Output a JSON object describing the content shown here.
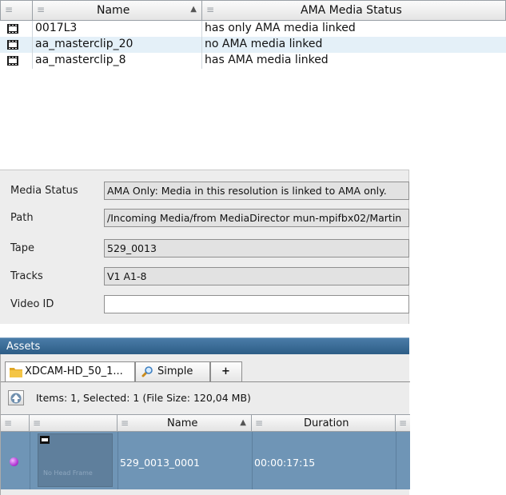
{
  "bin_table": {
    "columns": [
      {
        "label": ""
      },
      {
        "label": "Name"
      },
      {
        "label": "AMA Media Status"
      }
    ],
    "rows": [
      {
        "name": "0017L3",
        "status": "has only AMA media linked"
      },
      {
        "name": "aa_masterclip_20",
        "status": "no AMA media linked"
      },
      {
        "name": "aa_masterclip_8",
        "status": "has AMA media linked"
      }
    ]
  },
  "info_panel": {
    "media_status": {
      "label": "Media Status",
      "value": "AMA Only: Media in this resolution is linked to AMA only."
    },
    "path": {
      "label": "Path",
      "value": "/Incoming Media/from MediaDirector mun-mpifbx02/Martin"
    },
    "tape": {
      "label": "Tape",
      "value": "529_0013"
    },
    "tracks": {
      "label": "Tracks",
      "value": "V1 A1-8"
    },
    "video_id": {
      "label": "Video ID",
      "value": ""
    }
  },
  "assets": {
    "title": "Assets",
    "tabs": [
      {
        "label": "XDCAM-HD_50_1..."
      },
      {
        "label": "Simple"
      },
      {
        "label": "+"
      }
    ],
    "items_summary": "Items: 1, Selected: 1 (File Size: 120,04 MB)",
    "columns": [
      {
        "label": ""
      },
      {
        "label": ""
      },
      {
        "label": "Name"
      },
      {
        "label": "Duration"
      },
      {
        "label": ""
      }
    ],
    "rows": [
      {
        "thumbnail_text": "No Head Frame",
        "name": "529_0013_0001",
        "duration": "00:00:17:15"
      }
    ]
  },
  "colors": {
    "selection": "#6f95b6",
    "assets_header": "#2d5d86",
    "alt_row": "#e4f0f8"
  },
  "icons": {
    "clip": "clip-icon",
    "folder": "folder-icon",
    "search": "search-icon",
    "up": "arrow-up-icon",
    "status_dot": "status-dot-icon"
  }
}
